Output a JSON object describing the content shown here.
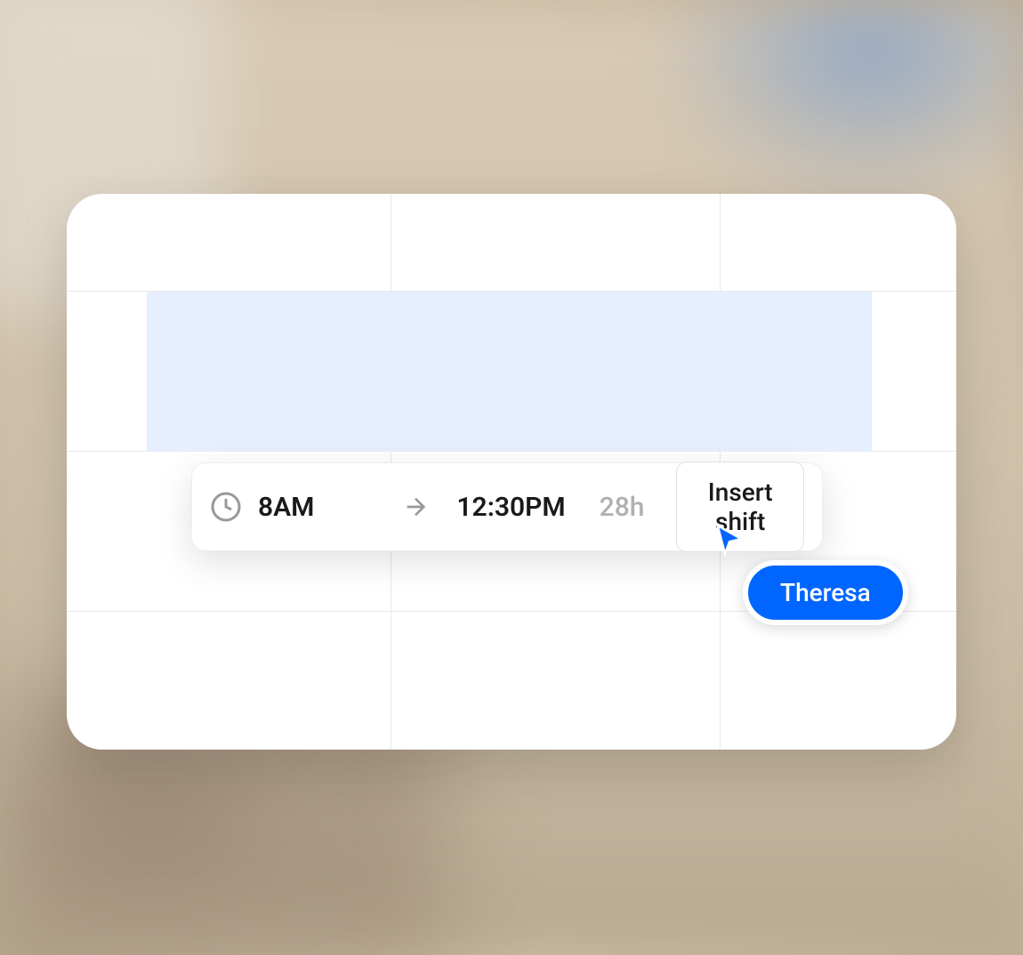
{
  "shift": {
    "start_time": "8AM",
    "end_time": "12:30PM",
    "duration": "28h"
  },
  "toolbar": {
    "insert_button_label": "Insert shift"
  },
  "collaborator": {
    "name": "Theresa"
  },
  "colors": {
    "accent": "#0066ff",
    "shift_block": "#e6efff"
  }
}
